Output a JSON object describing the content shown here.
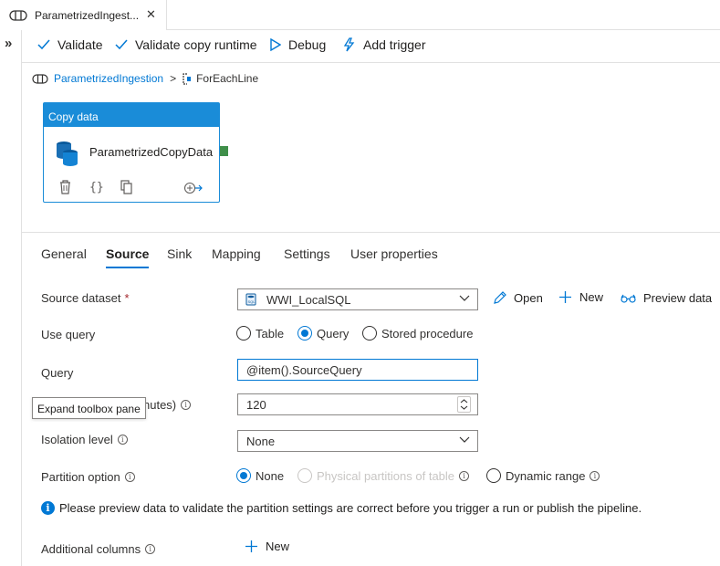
{
  "tab": {
    "title": "ParametrizedIngest...",
    "icon": "pipeline-icon",
    "close_glyph": "✕"
  },
  "left_rail": {
    "expander_glyph": "»",
    "tooltip": "Expand toolbox pane"
  },
  "toolbar": {
    "validate": "Validate",
    "validate_copy_runtime": "Validate copy runtime",
    "debug": "Debug",
    "add_trigger": "Add trigger"
  },
  "breadcrumb": {
    "pipeline": "ParametrizedIngestion",
    "separator": ">",
    "current": "ForEachLine"
  },
  "activity": {
    "type": "Copy data",
    "name": "ParametrizedCopyData"
  },
  "panel_tabs": [
    "General",
    "Source",
    "Sink",
    "Mapping",
    "Settings",
    "User properties"
  ],
  "active_tab": "Source",
  "form": {
    "source_dataset": {
      "label": "Source dataset",
      "required_mark": "*",
      "value": "WWI_LocalSQL",
      "open": "Open",
      "new": "New",
      "preview": "Preview data"
    },
    "use_query": {
      "label": "Use query",
      "options": [
        "Table",
        "Query",
        "Stored procedure"
      ],
      "selected": "Query"
    },
    "query": {
      "label": "Query",
      "value": "@item().SourceQuery"
    },
    "timeout": {
      "label_visible": "nutes)",
      "value": "120"
    },
    "isolation": {
      "label": "Isolation level",
      "value": "None"
    },
    "partition": {
      "label": "Partition option",
      "options": [
        "None",
        "Physical partitions of table",
        "Dynamic range"
      ],
      "selected": "None",
      "disabled": [
        "Physical partitions of table"
      ]
    },
    "notice": "Please preview data to validate the partition settings are correct before you trigger a run or publish the pipeline.",
    "additional_columns": {
      "label": "Additional columns",
      "new": "New"
    }
  },
  "colors": {
    "accent": "#0078d4",
    "card_header": "#1a8cd8",
    "port": "#3f8f4a",
    "required": "#a4262c"
  }
}
